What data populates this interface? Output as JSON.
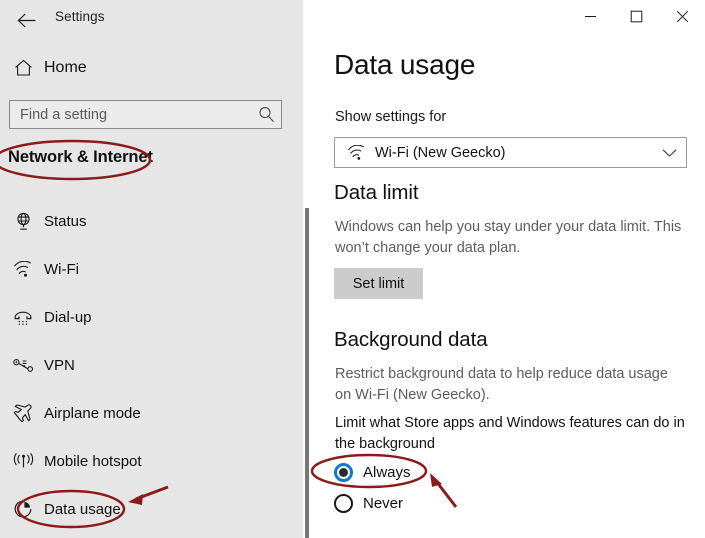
{
  "window": {
    "title": "Settings",
    "back_icon": "back-arrow-icon",
    "controls": {
      "minimize": "minimize-icon",
      "maximize": "maximize-icon",
      "close": "close-icon"
    }
  },
  "sidebar": {
    "home": {
      "label": "Home",
      "icon": "home-icon"
    },
    "search": {
      "placeholder": "Find a setting",
      "value": "",
      "icon": "search-icon"
    },
    "category_title": "Network & Internet",
    "items": [
      {
        "label": "Status",
        "icon": "globe-status-icon",
        "selected": false
      },
      {
        "label": "Wi-Fi",
        "icon": "wifi-icon",
        "selected": false
      },
      {
        "label": "Dial-up",
        "icon": "telephone-icon",
        "selected": false
      },
      {
        "label": "VPN",
        "icon": "vpn-icon",
        "selected": false
      },
      {
        "label": "Airplane mode",
        "icon": "airplane-icon",
        "selected": false
      },
      {
        "label": "Mobile hotspot",
        "icon": "hotspot-antenna-icon",
        "selected": false
      },
      {
        "label": "Data usage",
        "icon": "pie-chart-icon",
        "selected": true
      }
    ]
  },
  "main": {
    "page_title": "Data usage",
    "show_settings_label": "Show settings for",
    "network_dropdown": {
      "value": "Wi-Fi (New Geecko)",
      "icon": "wifi-icon",
      "chevron": "chevron-down-icon"
    },
    "data_limit": {
      "heading": "Data limit",
      "description": "Windows can help you stay under your data limit. This won’t change your data plan.",
      "button_label": "Set limit"
    },
    "background_data": {
      "heading": "Background data",
      "description": "Restrict background data to help reduce data usage on Wi-Fi (New Geecko).",
      "question": "Limit what Store apps and Windows features can do in the background",
      "options": [
        {
          "label": "Always",
          "checked": true
        },
        {
          "label": "Never",
          "checked": false
        }
      ]
    }
  },
  "annotations": {
    "color": "#8B1A1A",
    "ellipse_network_internet": "highlight-ellipse",
    "ellipse_data_usage": "highlight-ellipse",
    "ellipse_always": "highlight-ellipse",
    "arrow_data_usage": "pointer-arrow",
    "arrow_always": "pointer-arrow"
  },
  "colors": {
    "accent_blue": "#0C7AC7",
    "sidebar_bg": "#E6E6E6",
    "button_gray": "#CCCCCC",
    "annotation_red": "#8B1A1A"
  }
}
